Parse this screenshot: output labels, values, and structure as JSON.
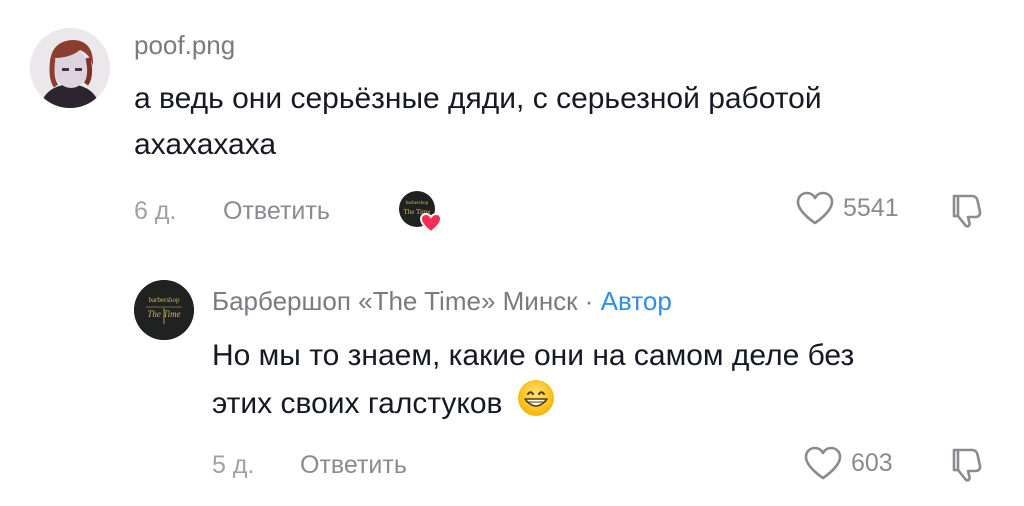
{
  "comments": [
    {
      "username": "poof.png",
      "text_line1": "а ведь они серьёзные дяди, с серьезной работой",
      "text_line2": "ахахахаха",
      "age": "6 д.",
      "reply_label": "Ответить",
      "likes": "5541"
    },
    {
      "username": "Барбершоп «The Time» Минск",
      "separator": " · ",
      "author_tag": "Автор",
      "text_line1": "Но мы то знаем, какие они на самом деле без",
      "text_line2": "этих своих галстуков",
      "age": "5 д.",
      "reply_label": "Ответить",
      "likes": "603"
    }
  ],
  "logo": {
    "line1": "barbershop",
    "line2": "The Time"
  },
  "colors": {
    "accent": "#2f8ee8",
    "heart": "#fe2c55",
    "muted": "#8a8b91"
  }
}
